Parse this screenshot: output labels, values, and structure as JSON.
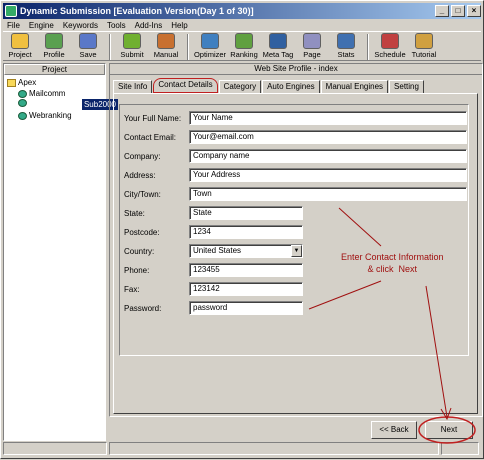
{
  "window": {
    "title": "Dynamic Submission [Evaluation Version(Day 1 of 30)]"
  },
  "menu": [
    "File",
    "Engine",
    "Keywords",
    "Tools",
    "Add-Ins",
    "Help"
  ],
  "toolbar": [
    {
      "label": "Project",
      "icon": "project-icon",
      "color": "#f0c040"
    },
    {
      "label": "Profile",
      "icon": "profile-icon",
      "color": "#5aa050"
    },
    {
      "label": "Save",
      "icon": "save-icon",
      "color": "#5a78c8"
    },
    {
      "label": "Submit",
      "icon": "submit-icon",
      "color": "#70b030"
    },
    {
      "label": "Manual",
      "icon": "manual-icon",
      "color": "#c87030"
    },
    {
      "label": "Optimizer",
      "icon": "optimizer-icon",
      "color": "#4080c0"
    },
    {
      "label": "Ranking",
      "icon": "ranking-icon",
      "color": "#60a040"
    },
    {
      "label": "Meta Tag",
      "icon": "meta-tag-icon",
      "color": "#3060a0"
    },
    {
      "label": "Page",
      "icon": "page-icon",
      "color": "#9090c0"
    },
    {
      "label": "Stats",
      "icon": "stats-icon",
      "color": "#4070b0"
    },
    {
      "label": "Schedule",
      "icon": "schedule-icon",
      "color": "#c04040"
    },
    {
      "label": "Tutorial",
      "icon": "tutorial-icon",
      "color": "#d0a040"
    }
  ],
  "project_panel": {
    "header": "Project",
    "root": "Apex",
    "items": [
      "Mailcomm",
      "Sub2000",
      "Webranking"
    ],
    "selected": "Sub2000"
  },
  "main": {
    "header": "Web Site Profile - index",
    "tabs": [
      "Site Info",
      "Contact Details",
      "Category",
      "Auto Engines",
      "Manual Engines",
      "Setting"
    ],
    "active_tab": "Contact Details"
  },
  "form": {
    "full_name": {
      "label": "Your Full Name:",
      "value": "Your Name"
    },
    "email": {
      "label": "Contact Email:",
      "value": "Your@email.com"
    },
    "company": {
      "label": "Company:",
      "value": "Company name"
    },
    "address": {
      "label": "Address:",
      "value": "Your Address"
    },
    "city": {
      "label": "City/Town:",
      "value": "Town"
    },
    "state": {
      "label": "State:",
      "value": "State"
    },
    "postcode": {
      "label": "Postcode:",
      "value": "1234"
    },
    "country": {
      "label": "Country:",
      "value": "United States"
    },
    "phone": {
      "label": "Phone:",
      "value": "123455"
    },
    "fax": {
      "label": "Fax:",
      "value": "123142"
    },
    "password": {
      "label": "Password:",
      "value": "password"
    }
  },
  "annotation": "Enter Contact Information\n& click  Next",
  "buttons": {
    "back": "<< Back",
    "next": "Next"
  },
  "colors": {
    "annotation": "#a01010",
    "selection": "#0a246a"
  }
}
